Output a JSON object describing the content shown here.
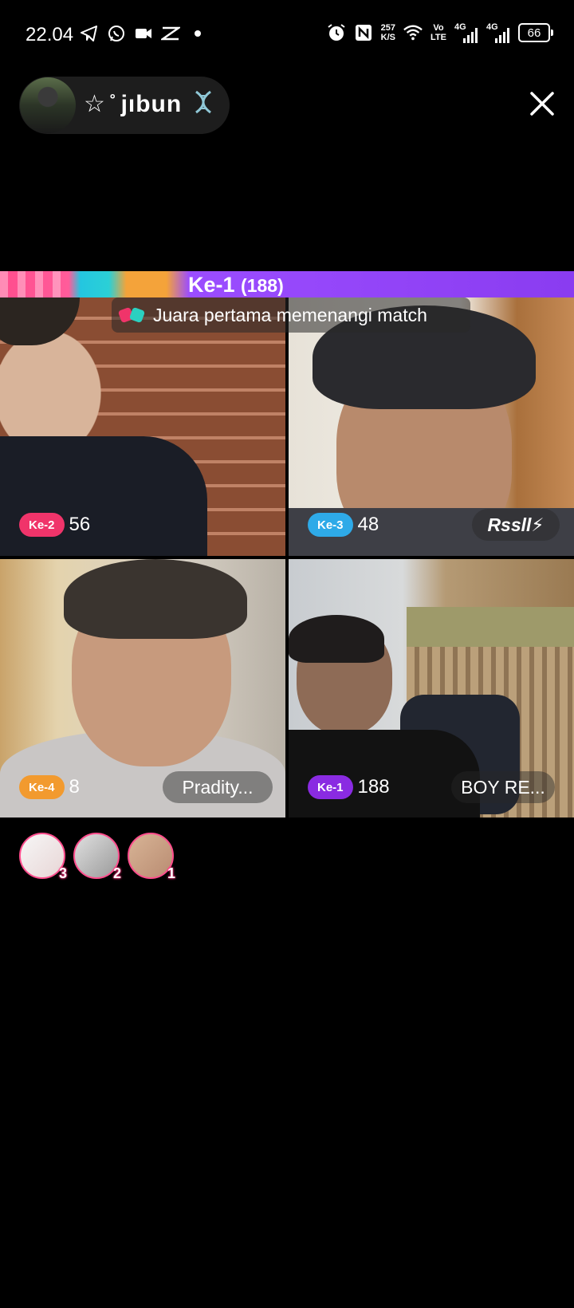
{
  "status_bar": {
    "time": "22.04",
    "net_speed_value": "257",
    "net_speed_unit": "K/S",
    "volte_top": "Vo",
    "volte_bottom": "LTE",
    "signal1": "4G",
    "signal2": "4G",
    "battery": "66"
  },
  "host": {
    "name": "☆ ̊ jıbun"
  },
  "match": {
    "rank": "Ke-1",
    "score": "(188)",
    "notice": "Juara pertama memenangi match"
  },
  "players": [
    {
      "rank": "Ke-2",
      "score": "56",
      "name": "",
      "rank_color": "#f0346a"
    },
    {
      "rank": "Ke-3",
      "score": "48",
      "name": "Rssll⚡",
      "rank_color": "#2eaae8"
    },
    {
      "rank": "Ke-4",
      "score": "8",
      "name": "Pradity...",
      "rank_color": "#f29a2e"
    },
    {
      "rank": "Ke-1",
      "score": "188",
      "name": "BOY RE...",
      "rank_color": "#8a2be2"
    }
  ],
  "top_viewers": [
    {
      "rank": "3"
    },
    {
      "rank": "2"
    },
    {
      "rank": "1"
    }
  ]
}
